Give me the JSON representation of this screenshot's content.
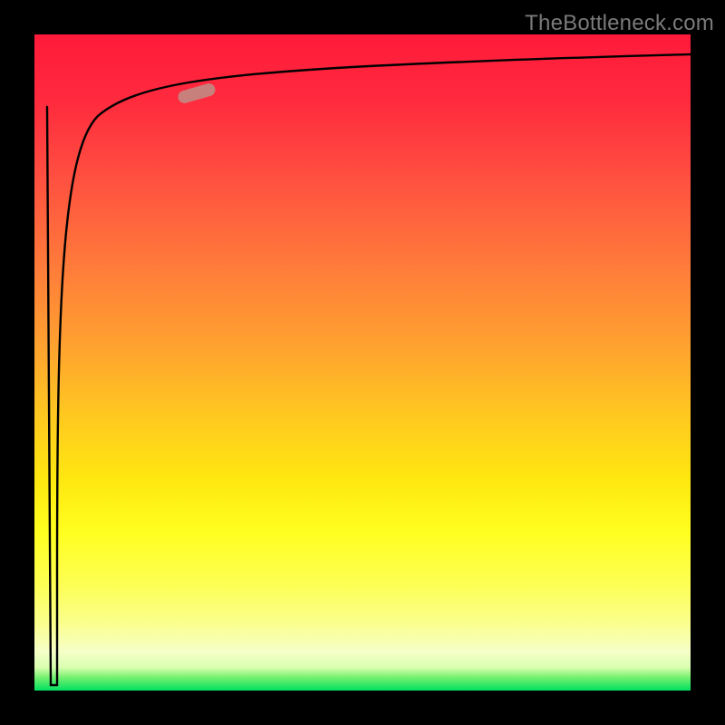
{
  "watermark": "TheBottleneck.com",
  "colors": {
    "curve": "#000000",
    "marker": "#c8807c",
    "frame": "#000000"
  },
  "chart_data": {
    "type": "line",
    "title": "",
    "xlabel": "",
    "ylabel": "",
    "x": [
      0,
      1,
      2,
      3,
      4,
      5,
      6,
      8,
      10,
      15,
      20,
      30,
      40,
      60,
      80,
      100
    ],
    "values": [
      0,
      12,
      40,
      60,
      72,
      80,
      84,
      88,
      90,
      92,
      93.5,
      95,
      96,
      97,
      97.5,
      98
    ],
    "xlim": [
      0,
      100
    ],
    "ylim": [
      0,
      100
    ],
    "marker_point": {
      "x": 24,
      "y": 94
    },
    "grid": false,
    "legend": false,
    "background_gradient": [
      "#ff1a3a",
      "#ffa030",
      "#ffff20",
      "#00e060"
    ]
  }
}
